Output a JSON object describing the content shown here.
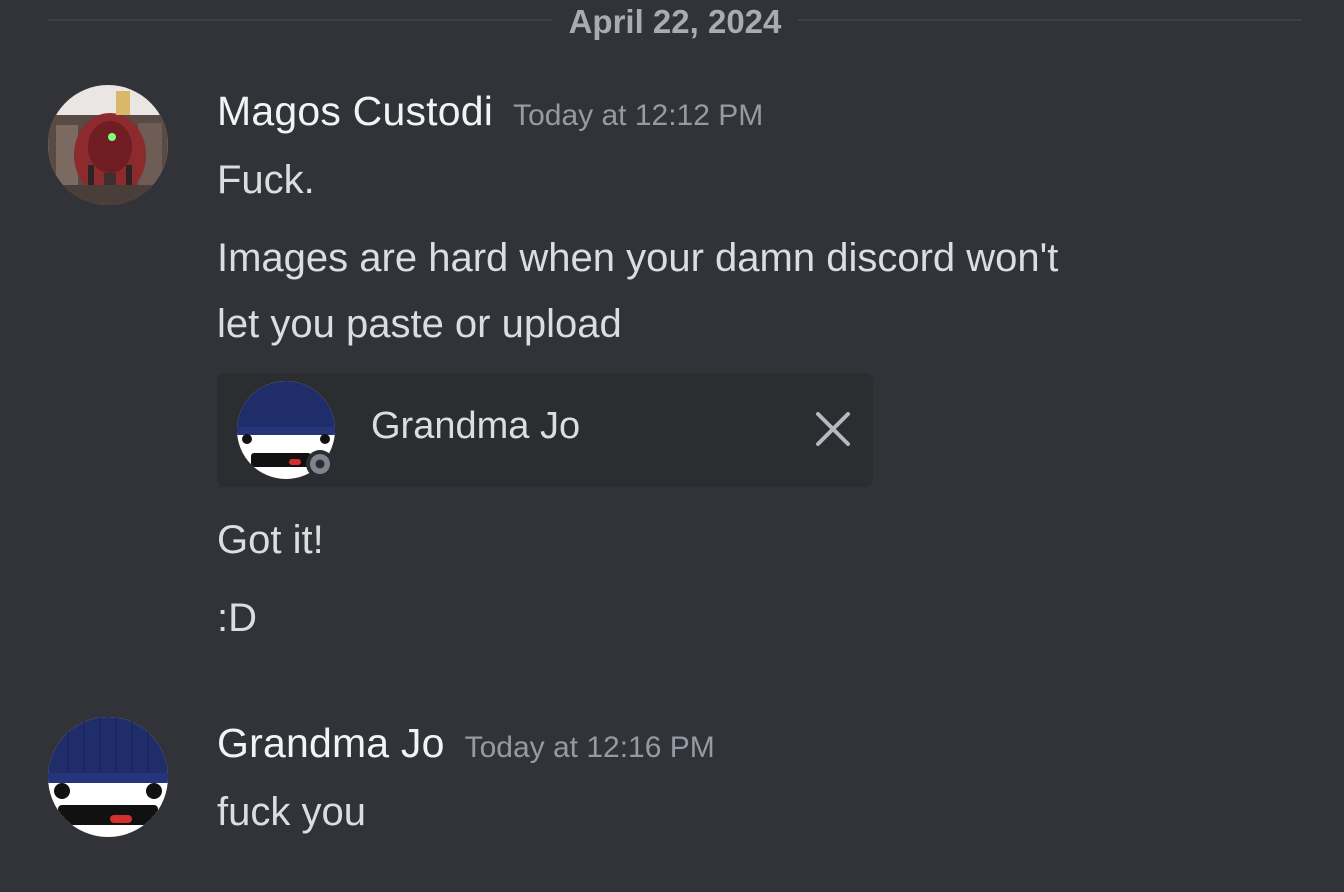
{
  "date_divider": "April 22, 2024",
  "messages": [
    {
      "username": "Magos Custodi",
      "timestamp": "Today at 12:12 PM",
      "lines": [
        "Fuck.",
        "Images are hard when your damn discord won't",
        "let you paste or upload"
      ],
      "embed": {
        "name": "Grandma Jo"
      },
      "after_lines": [
        "Got it!",
        ":D"
      ]
    },
    {
      "username": "Grandma Jo",
      "timestamp": "Today at 12:16 PM",
      "lines": [
        "fuck you"
      ]
    }
  ],
  "colors": {
    "background": "#313338",
    "card_background": "#2b2d31",
    "beanie_blue": "#1f2d6b"
  },
  "icons": {
    "close": "close-icon",
    "status": "status-offline-icon"
  }
}
